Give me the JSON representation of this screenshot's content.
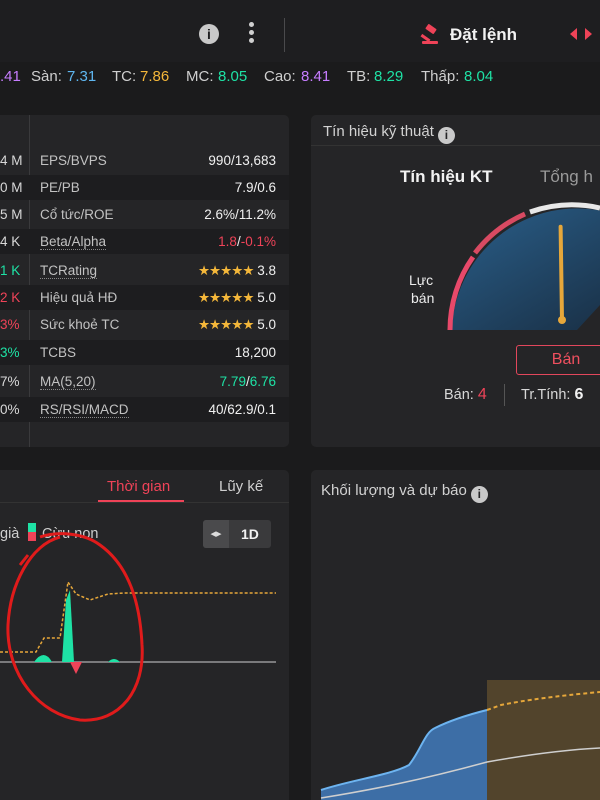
{
  "header": {
    "info_icon": "info-icon",
    "more_icon": "kebab-icon",
    "order_label": "Đặt lệnh",
    "order_icon": "gavel-icon",
    "swap_icon": "arrows-left-right-icon"
  },
  "pricebar": {
    "first_value": ".41",
    "san_label": "Sàn:",
    "san_value": "7.31",
    "tc_label": "TC:",
    "tc_value": "7.86",
    "mc_label": "MC:",
    "mc_value": "8.05",
    "cao_label": "Cao:",
    "cao_value": "8.41",
    "tb_label": "TB:",
    "tb_value": "8.29",
    "thap_label": "Thấp:",
    "thap_value": "8.04"
  },
  "stats": {
    "rows": [
      {
        "left": "4 M",
        "name": "EPS/BVPS",
        "value": "990/13,683"
      },
      {
        "left": "0 M",
        "name": "PE/PB",
        "value": "7.9/0.6"
      },
      {
        "left": "5 M",
        "name": "Cổ tức/ROE",
        "value": "2.6%/11.2%"
      },
      {
        "left": "4 K",
        "name": "Beta/Alpha",
        "value_a": "1.8",
        "value_b": "-0.1%"
      },
      {
        "left": "1 K",
        "name": "TCRating",
        "stars": "★★★★★",
        "value": "3.8"
      },
      {
        "left": "2 K",
        "name": "Hiệu quả HĐ",
        "stars": "★★★★★",
        "value": "5.0"
      },
      {
        "left": "3%",
        "name": "Sức khoẻ TC",
        "stars": "★★★★★",
        "value": "5.0"
      },
      {
        "left": "3%",
        "name": "TCBS",
        "value": "18,200"
      },
      {
        "left": "7%",
        "name": "MA(5,20)",
        "value_a": "7.79",
        "value_b": "6.76"
      },
      {
        "left": "0%",
        "name": "RS/RSI/MACD",
        "value": "40/62.9/0.1"
      }
    ]
  },
  "tech": {
    "title": "Tín hiệu kỹ thuật",
    "tab_active": "Tín hiệu KT",
    "tab_other": "Tổng h",
    "gauge_label_1": "Lực",
    "gauge_label_2": "bán",
    "gauge_level": 0.3,
    "signal": "Bán",
    "sell_label": "Bán:",
    "sell_count": "4",
    "neutral_label": "Tr.Tính:",
    "neutral_count": "6"
  },
  "timechart": {
    "tab_active": "Thời gian",
    "tab_other": "Lũy kế",
    "legend_a": "già",
    "legend_b": "Cừu non",
    "period": "1D"
  },
  "volume": {
    "title": "Khối lượng và dự báo"
  },
  "colors": {
    "purple": "#c77dff",
    "blue": "#5fb7f0",
    "orange": "#f4b73a",
    "green": "#1ee2a5",
    "red": "#ef4358"
  }
}
